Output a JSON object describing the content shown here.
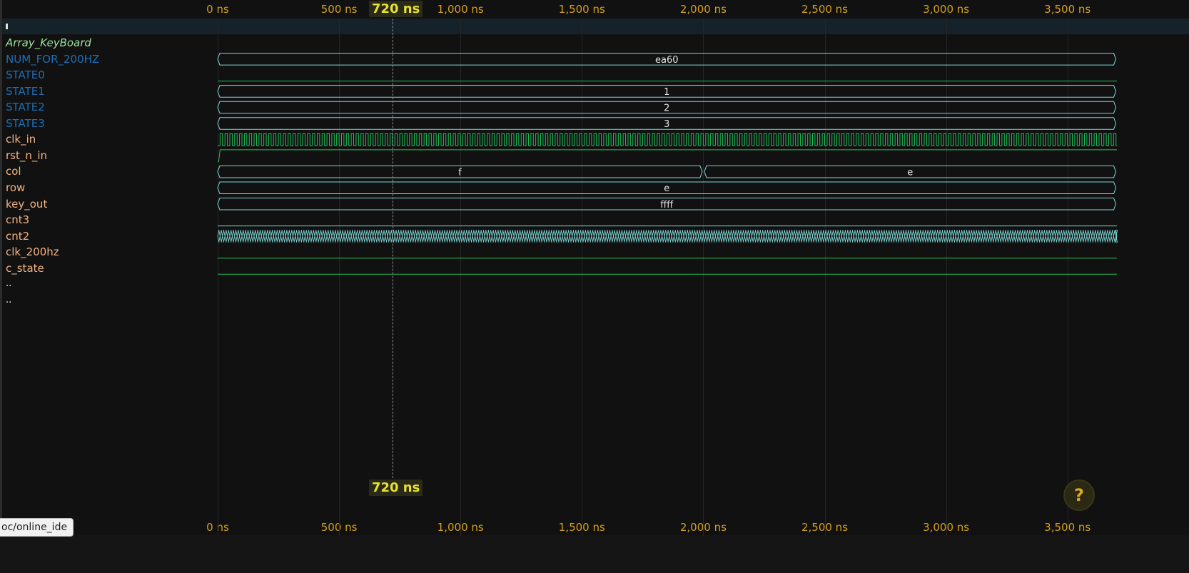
{
  "axis": {
    "ticks": [
      {
        "ns": 0,
        "label": "0 ns"
      },
      {
        "ns": 500,
        "label": "500 ns"
      },
      {
        "ns": 1000,
        "label": "1,000 ns"
      },
      {
        "ns": 1500,
        "label": "1,500 ns"
      },
      {
        "ns": 2000,
        "label": "2,000 ns"
      },
      {
        "ns": 2500,
        "label": "2,500 ns"
      },
      {
        "ns": 3000,
        "label": "3,000 ns"
      },
      {
        "ns": 3500,
        "label": "3,500 ns"
      }
    ]
  },
  "cursor": {
    "time_ns": 720,
    "label": "720 ns"
  },
  "scope": {
    "name": "Array_KeyBoard"
  },
  "signals": [
    {
      "name": "NUM_FOR_200HZ",
      "kind": "param",
      "type": "bus",
      "segments": [
        {
          "from_ns": 0,
          "to_ns": 3710,
          "value": "ea60"
        }
      ]
    },
    {
      "name": "STATE0",
      "kind": "param",
      "type": "bit",
      "value": 0
    },
    {
      "name": "STATE1",
      "kind": "param",
      "type": "bus",
      "segments": [
        {
          "from_ns": 0,
          "to_ns": 3710,
          "value": "1"
        }
      ]
    },
    {
      "name": "STATE2",
      "kind": "param",
      "type": "bus",
      "segments": [
        {
          "from_ns": 0,
          "to_ns": 3710,
          "value": "2"
        }
      ]
    },
    {
      "name": "STATE3",
      "kind": "param",
      "type": "bus",
      "segments": [
        {
          "from_ns": 0,
          "to_ns": 3710,
          "value": "3"
        }
      ]
    },
    {
      "name": "clk_in",
      "kind": "net",
      "type": "clock",
      "period_ns": 20
    },
    {
      "name": "rst_n_in",
      "kind": "net",
      "type": "bit",
      "rise_ns": 10
    },
    {
      "name": "col",
      "kind": "net",
      "type": "bus",
      "segments": [
        {
          "from_ns": 0,
          "to_ns": 2000,
          "value": "f"
        },
        {
          "from_ns": 2000,
          "to_ns": 3710,
          "value": "e"
        }
      ]
    },
    {
      "name": "row",
      "kind": "net",
      "type": "bus",
      "segments": [
        {
          "from_ns": 0,
          "to_ns": 3710,
          "value": "e"
        }
      ]
    },
    {
      "name": "key_out",
      "kind": "net",
      "type": "bus",
      "segments": [
        {
          "from_ns": 0,
          "to_ns": 3710,
          "value": "ffff"
        }
      ]
    },
    {
      "name": "cnt3",
      "kind": "net",
      "type": "flat"
    },
    {
      "name": "cnt2",
      "kind": "net",
      "type": "busclock",
      "period_ns": 20
    },
    {
      "name": "clk_200hz",
      "kind": "net",
      "type": "bit",
      "value": 0
    },
    {
      "name": "c_state",
      "kind": "net",
      "type": "bit",
      "value": 0
    }
  ],
  "trailing_rows": [
    {
      "name": ".."
    },
    {
      "name": ".."
    }
  ],
  "help": {
    "glyph": "?"
  },
  "status": {
    "url": "oc/online_ide"
  },
  "colors": {
    "wave": "#21c25a",
    "bus": "#7fd6d6",
    "tick": "#d39f1e",
    "cursor": "#e8e22b"
  }
}
